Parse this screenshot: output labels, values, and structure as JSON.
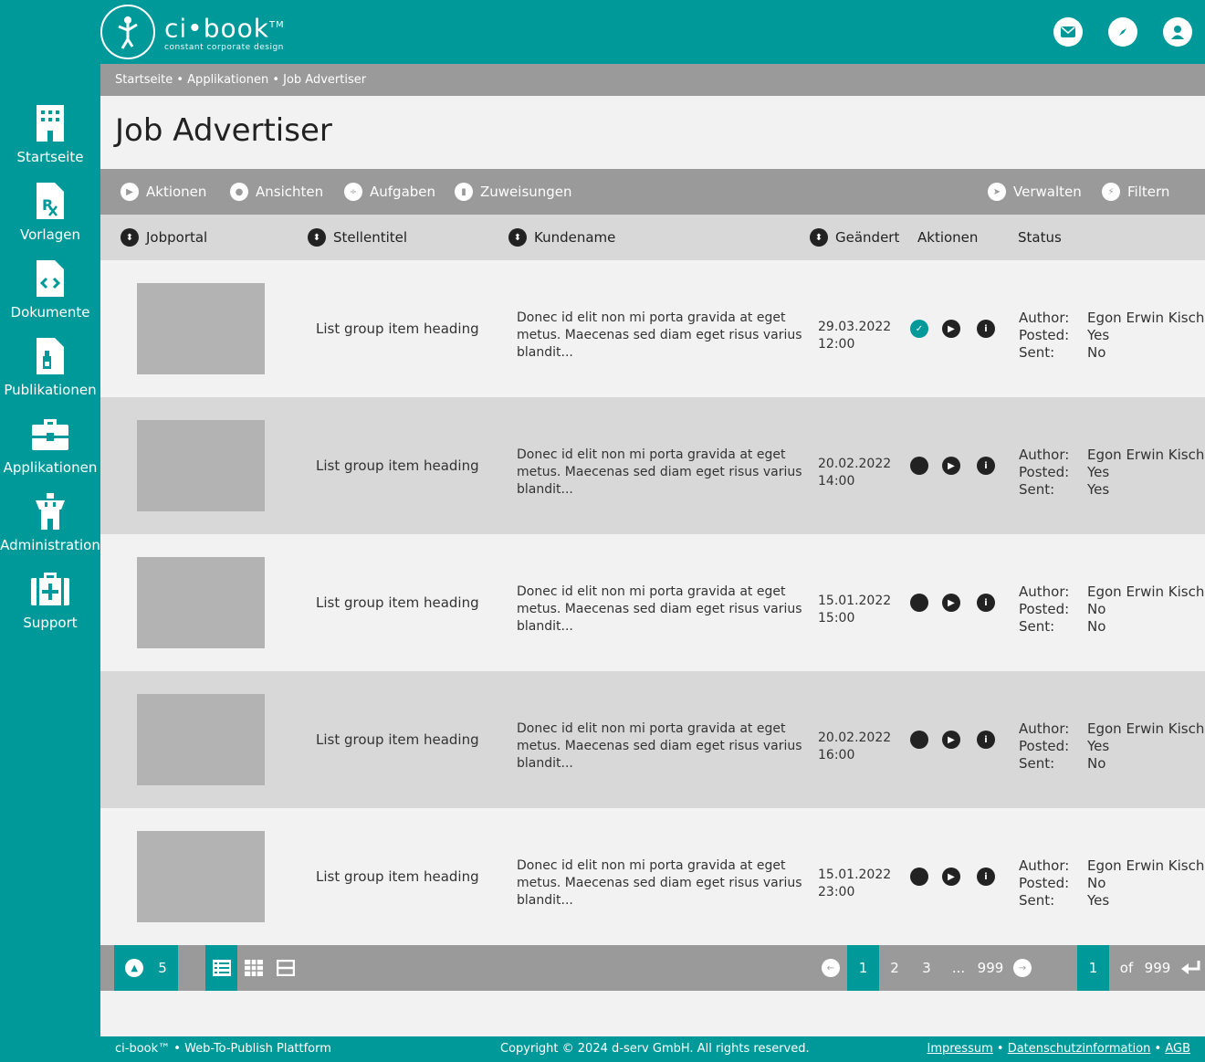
{
  "header": {
    "logo_name": "ci•book",
    "logo_tm": "TM",
    "logo_tagline": "constant corporate design",
    "icons": [
      "mail-icon",
      "compass-icon",
      "user-icon"
    ]
  },
  "sidebar": {
    "items": [
      {
        "label": "Startseite",
        "icon": "building-icon"
      },
      {
        "label": "Vorlagen",
        "icon": "prescription-file-icon"
      },
      {
        "label": "Dokumente",
        "icon": "code-file-icon"
      },
      {
        "label": "Publikationen",
        "icon": "bottle-file-icon"
      },
      {
        "label": "Applikationen",
        "icon": "toolbox-icon"
      },
      {
        "label": "Administration",
        "icon": "tower-icon"
      },
      {
        "label": "Support",
        "icon": "medical-kit-icon"
      }
    ]
  },
  "breadcrumb": "Startseite • Applikationen • Job Advertiser",
  "page_title": "Job Advertiser",
  "toolbar": {
    "aktionen": "Aktionen",
    "ansichten": "Ansichten",
    "aufgaben": "Aufgaben",
    "zuweisungen": "Zuweisungen",
    "verwalten": "Verwalten",
    "filtern": "Filtern"
  },
  "columns": {
    "jobportal": "Jobportal",
    "stellentitel": "Stellentitel",
    "kundenname": "Kundename",
    "geaendert": "Geändert",
    "aktionen": "Aktionen",
    "status": "Status"
  },
  "status_labels": {
    "author": "Author:",
    "posted": "Posted:",
    "sent": "Sent:"
  },
  "rows": [
    {
      "heading": "List group item heading",
      "desc": "Donec id elit non mi porta gravida at eget metus. Maecenas sed diam eget risus varius blandit...",
      "date": "29.03.2022",
      "time": "12:00",
      "checked": true,
      "author": "Egon Erwin Kisch",
      "posted": "Yes",
      "sent": "No"
    },
    {
      "heading": "List group item heading",
      "desc": "Donec id elit non mi porta gravida at eget metus. Maecenas sed diam eget risus varius blandit...",
      "date": "20.02.2022",
      "time": "14:00",
      "checked": false,
      "author": "Egon Erwin Kisch",
      "posted": "Yes",
      "sent": "Yes"
    },
    {
      "heading": "List group item heading",
      "desc": "Donec id elit non mi porta gravida at eget metus. Maecenas sed diam eget risus varius blandit...",
      "date": "15.01.2022",
      "time": "15:00",
      "checked": false,
      "author": "Egon Erwin Kisch",
      "posted": "No",
      "sent": "No"
    },
    {
      "heading": "List group item heading",
      "desc": "Donec id elit non mi porta gravida at eget metus. Maecenas sed diam eget risus varius blandit...",
      "date": "20.02.2022",
      "time": "16:00",
      "checked": false,
      "author": "Egon Erwin Kisch",
      "posted": "Yes",
      "sent": "No"
    },
    {
      "heading": "List group item heading",
      "desc": "Donec id elit non mi porta gravida at eget metus. Maecenas sed diam eget risus varius blandit...",
      "date": "15.01.2022",
      "time": "23:00",
      "checked": false,
      "author": "Egon Erwin Kisch",
      "posted": "No",
      "sent": "Yes"
    }
  ],
  "pager": {
    "per_page": "5",
    "pages": [
      "1",
      "2",
      "3",
      "...",
      "999"
    ],
    "current_page": "1",
    "of_label": "of",
    "total_pages": "999"
  },
  "footer": {
    "left": "ci-book™ • Web-To-Publish Plattform",
    "copyright": "Copyright © 2024 d-serv GmbH. All rights reserved.",
    "impressum": "Impressum",
    "datenschutz": "Datenschutzinformation",
    "agb": "AGB",
    "sep": "•"
  },
  "colors": {
    "brand": "#00999a",
    "bar_gray": "#9a9a9a",
    "light_gray": "#d8d8d8",
    "bg": "#f2f2f2"
  }
}
